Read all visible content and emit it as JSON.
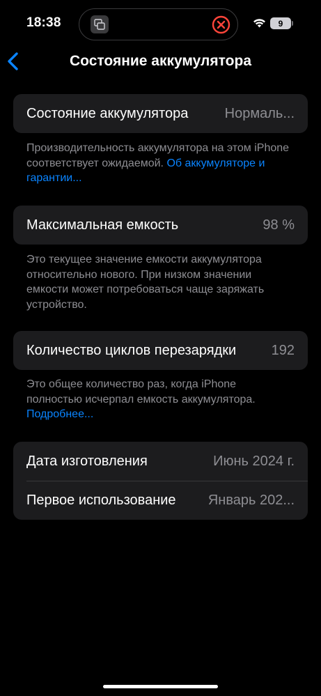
{
  "status_bar": {
    "time": "18:38",
    "battery_level": "9",
    "icons": [
      "screen-mirroring-icon",
      "close-circle-icon",
      "wifi-icon",
      "battery-icon"
    ]
  },
  "nav": {
    "back_icon": "chevron-left-icon",
    "title": "Состояние аккумулятора"
  },
  "health": {
    "label": "Состояние аккумулятора",
    "value": "Нормаль...",
    "footnote": "Производительность аккумулятора на этом iPhone соответствует ожидаемой.",
    "link": "Об аккумуляторе и гарантии..."
  },
  "capacity": {
    "label": "Максимальная емкость",
    "value": "98 %",
    "footnote": "Это текущее значение емкости аккумулятора относительно нового. При низком значении емкости может потребоваться чаще заряжать устройство."
  },
  "cycles": {
    "label": "Количество циклов перезарядки",
    "value": "192",
    "footnote": "Это общее количество раз, когда iPhone полностью исчерпал емкость аккумулятора.",
    "link": "Подробнее..."
  },
  "dates": {
    "manufacture_label": "Дата изготовления",
    "manufacture_value": "Июнь 2024 г.",
    "first_use_label": "Первое использование",
    "first_use_value": "Январь 202..."
  },
  "colors": {
    "background": "#000000",
    "card": "#1c1c1e",
    "secondary_text": "#8e8e93",
    "link": "#0a84ff",
    "close_red": "#ff453a"
  }
}
